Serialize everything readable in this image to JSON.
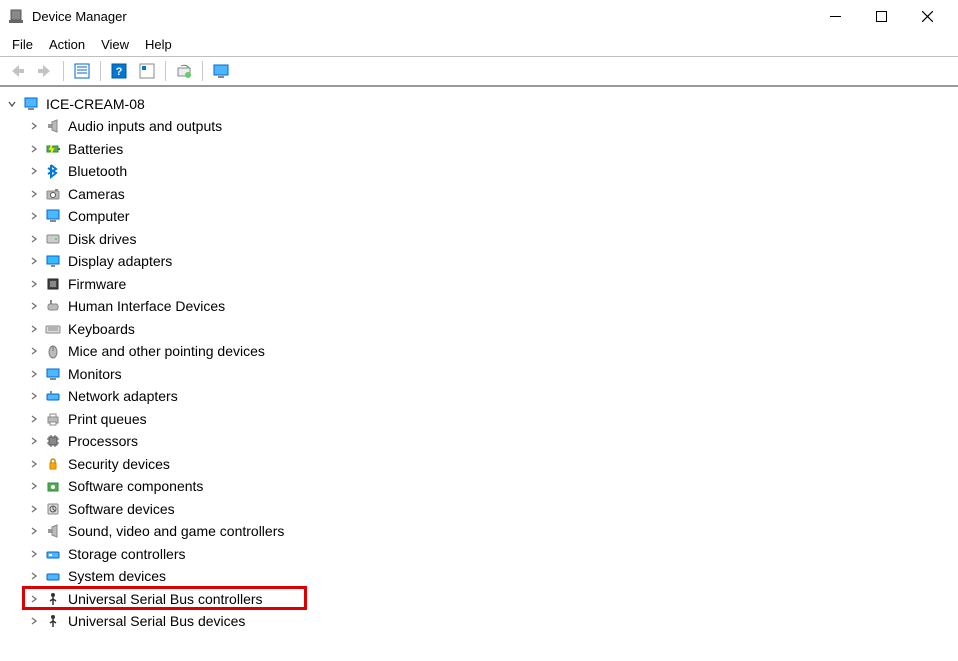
{
  "window": {
    "title": "Device Manager"
  },
  "menu": {
    "file": "File",
    "action": "Action",
    "view": "View",
    "help": "Help"
  },
  "toolbar": {
    "back": "Back",
    "forward": "Forward",
    "properties": "Properties",
    "help": "Help",
    "scan": "Scan for hardware changes",
    "add": "Add legacy hardware",
    "show": "Show hidden devices"
  },
  "tree": {
    "root": "ICE-CREAM-08",
    "items": [
      {
        "label": "Audio inputs and outputs",
        "icon": "speaker"
      },
      {
        "label": "Batteries",
        "icon": "battery"
      },
      {
        "label": "Bluetooth",
        "icon": "bluetooth"
      },
      {
        "label": "Cameras",
        "icon": "camera"
      },
      {
        "label": "Computer",
        "icon": "computer"
      },
      {
        "label": "Disk drives",
        "icon": "disk"
      },
      {
        "label": "Display adapters",
        "icon": "display"
      },
      {
        "label": "Firmware",
        "icon": "firmware"
      },
      {
        "label": "Human Interface Devices",
        "icon": "hid"
      },
      {
        "label": "Keyboards",
        "icon": "keyboard"
      },
      {
        "label": "Mice and other pointing devices",
        "icon": "mouse"
      },
      {
        "label": "Monitors",
        "icon": "monitor"
      },
      {
        "label": "Network adapters",
        "icon": "network"
      },
      {
        "label": "Print queues",
        "icon": "printer"
      },
      {
        "label": "Processors",
        "icon": "cpu"
      },
      {
        "label": "Security devices",
        "icon": "security"
      },
      {
        "label": "Software components",
        "icon": "component"
      },
      {
        "label": "Software devices",
        "icon": "softdev"
      },
      {
        "label": "Sound, video and game controllers",
        "icon": "sound"
      },
      {
        "label": "Storage controllers",
        "icon": "storage"
      },
      {
        "label": "System devices",
        "icon": "system"
      },
      {
        "label": "Universal Serial Bus controllers",
        "icon": "usb",
        "highlight": true
      },
      {
        "label": "Universal Serial Bus devices",
        "icon": "usbdev"
      }
    ]
  }
}
